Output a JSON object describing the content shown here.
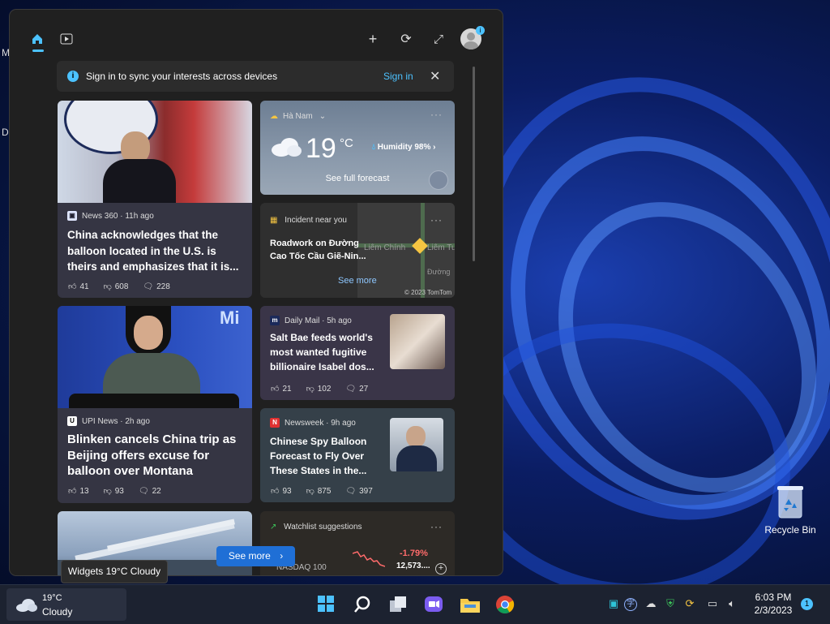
{
  "desktop": {
    "left_letters": [
      "M",
      "D"
    ],
    "recycle_bin_label": "Recycle Bin"
  },
  "widgets": {
    "signin_bar": {
      "message": "Sign in to sync your interests across devices",
      "link": "Sign in"
    },
    "news_1": {
      "source": "News 360 · 11h ago",
      "headline": "China acknowledges that the balloon located in the U.S. is theirs and emphasizes that it is...",
      "likes": "41",
      "dislikes": "608",
      "comments": "228"
    },
    "weather_card": {
      "location": "Hà Nam",
      "temp": "19",
      "unit": "°C",
      "humidity": "Humidity 98%",
      "forecast_link": "See full forecast"
    },
    "incident_card": {
      "title": "Incident near you",
      "text": "Roadwork on Đường Cao Tốc Cầu Giẽ-Nin...",
      "link": "See more",
      "map_label_1": "Liêm Chính",
      "map_label_2": "Liêm Tu",
      "map_label_3": "Đường",
      "map_credit": "© 2023 TomTom"
    },
    "news_2": {
      "source": "UPI News · 2h ago",
      "headline": "Blinken cancels China trip as Beijing offers excuse for balloon over Montana",
      "likes": "13",
      "dislikes": "93",
      "comments": "22",
      "image_sign": "Mi"
    },
    "news_3": {
      "source": "Daily Mail · 5h ago",
      "headline": "Salt Bae feeds world's most wanted fugitive billionaire Isabel dos...",
      "likes": "21",
      "dislikes": "102",
      "comments": "27"
    },
    "news_4": {
      "source": "Newsweek · 9h ago",
      "headline": "Chinese Spy Balloon Forecast to Fly Over These States in the...",
      "likes": "93",
      "dislikes": "875",
      "comments": "397"
    },
    "watchlist": {
      "title": "Watchlist suggestions",
      "index": "NASDAQ 100",
      "change": "-1.79%",
      "value": "12,573...."
    },
    "see_more_button": "See more",
    "tooltip": "Widgets 19°C Cloudy"
  },
  "taskbar": {
    "weather_temp": "19°C",
    "weather_cond": "Cloudy",
    "time": "6:03 PM",
    "date": "2/3/2023",
    "notification_count": "1"
  },
  "colors": {
    "accent": "#4cc2ff",
    "negative": "#ff6b6b",
    "button_blue": "#1f6fd6"
  }
}
